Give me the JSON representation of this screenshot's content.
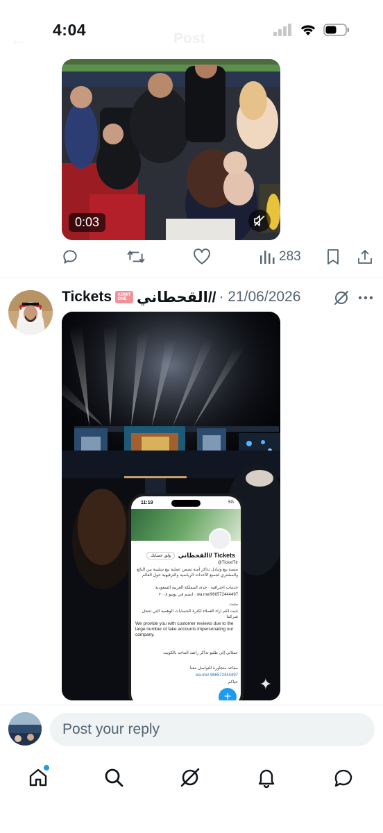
{
  "status_bar": {
    "time": "4:04"
  },
  "header": {
    "title": "Post",
    "back_icon": "arrow-left-icon"
  },
  "post1": {
    "media_duration": "0:03",
    "mute_icon": "speaker-muted-icon",
    "actions": {
      "reply_icon": "reply-icon",
      "repost_icon": "repost-icon",
      "like_icon": "heart-icon",
      "views_icon": "views-bar-icon",
      "views_count": "283",
      "bookmark_icon": "bookmark-icon",
      "share_icon": "share-icon"
    }
  },
  "post2": {
    "author_name": "Tickets",
    "badge_text": "ADMIT ONE",
    "author_handle": "القحطاني//",
    "date": "· 21/06/2026",
    "grok_icon": "grok-icon",
    "more_icon": "more-dots-icon",
    "phone_screenshot": {
      "time": "11:19",
      "signal": "5G",
      "follow_label": "ولق حسابك",
      "profile_name": "القحطاني// Tickets",
      "profile_handle": "@TicketTtr",
      "bio": "منصة بيع وتبادل تذاكر آمنة تضمن عملية بيع سلسة بين البائع والمشتري لجميع الأحداث الرياضية والترفيهية حول العالم",
      "meta1": "خدمات احترافية · جدة، المملكة العربية السعودية",
      "meta2": "انضم في يونيو ٢٠٠٨ · wa.me/966572444497",
      "pinned_label": "مثبت",
      "pinned_text_ar": "نثبت لكم اراء العملاء لكثرة الحسابات الوهمية التي تنتحل شركتنا",
      "pinned_text_en": "We provide you with customer reviews due to the large number of fake accounts impersonating our company.",
      "reply_text_ar": "عملائي إلى طلبو تذاكر راشد الماجد بالكويت",
      "reply_text2_ar": "مقاعد متجاورة للتواصل معنا",
      "link_text": "wa.me/ 966572444497",
      "closing_text": "حياكم"
    }
  },
  "reply_bar": {
    "placeholder": "Post your reply"
  },
  "bottom_nav": {
    "items": [
      {
        "icon": "home-icon",
        "active": true
      },
      {
        "icon": "search-icon"
      },
      {
        "icon": "grok-icon"
      },
      {
        "icon": "bell-icon"
      },
      {
        "icon": "messages-icon"
      }
    ]
  },
  "colors": {
    "accent": "#1d9bf0",
    "text_secondary": "#536471",
    "divider": "#eff3f4",
    "badge": "#f4909a"
  }
}
